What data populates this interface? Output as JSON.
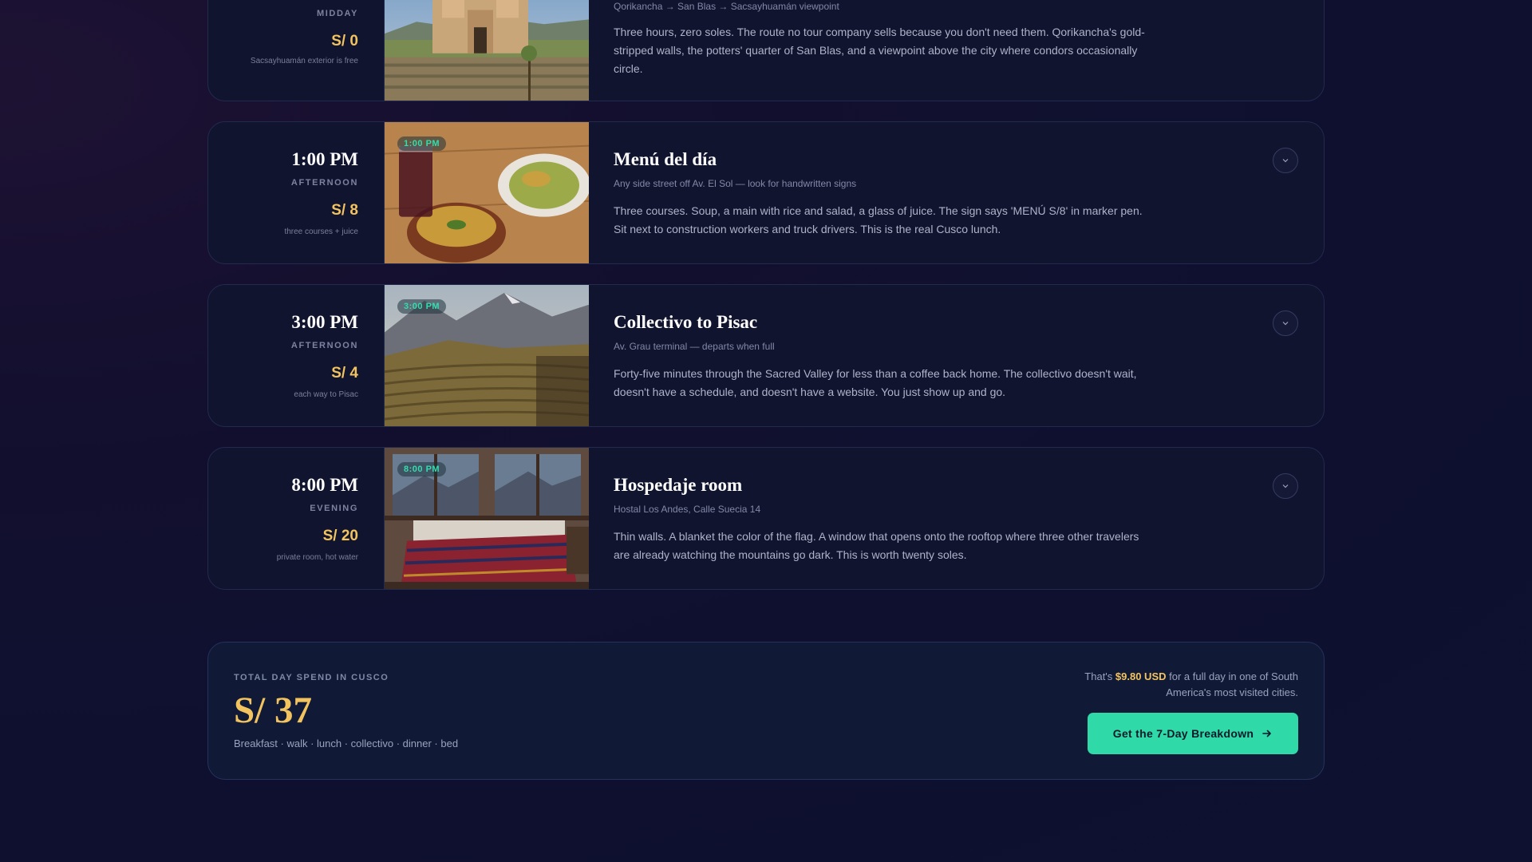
{
  "cards": [
    {
      "time": "",
      "period": "MIDDAY",
      "price": "S/ 0",
      "price_note": "Sacsayhuamán exterior is free",
      "badge": "",
      "title": "",
      "subtitle": "Qorikancha → San Blas → Sacsayhuamán viewpoint",
      "description": "Three hours, zero soles. The route no tour company sells because you don't need them. Qorikancha's gold-stripped walls, the potters' quarter of San Blas, and a viewpoint above the city where condors occasionally circle.",
      "image": "church-plaza-image"
    },
    {
      "time": "1:00 PM",
      "period": "AFTERNOON",
      "price": "S/ 8",
      "price_note": "three courses + juice",
      "badge": "1:00 PM",
      "title": "Menú del día",
      "subtitle": "Any side street off Av. El Sol — look for handwritten signs",
      "description": "Three courses. Soup, a main with rice and salad, a glass of juice. The sign says 'MENÚ S/8' in marker pen. Sit next to construction workers and truck drivers. This is the real Cusco lunch.",
      "image": "lunch-plates-image"
    },
    {
      "time": "3:00 PM",
      "period": "AFTERNOON",
      "price": "S/ 4",
      "price_note": "each way to Pisac",
      "badge": "3:00 PM",
      "title": "Collectivo to Pisac",
      "subtitle": "Av. Grau terminal — departs when full",
      "description": "Forty-five minutes through the Sacred Valley for less than a coffee back home. The collectivo doesn't wait, doesn't have a schedule, and doesn't have a website. You just show up and go.",
      "image": "sacred-valley-image"
    },
    {
      "time": "8:00 PM",
      "period": "EVENING",
      "price": "S/ 20",
      "price_note": "private room, hot water",
      "badge": "8:00 PM",
      "title": "Hospedaje room",
      "subtitle": "Hostal Los Andes, Calle Suecia 14",
      "description": "Thin walls. A blanket the color of the flag. A window that opens onto the rooftop where three other travelers are already watching the mountains go dark. This is worth twenty soles.",
      "image": "hostel-room-image"
    }
  ],
  "summary": {
    "label": "TOTAL DAY SPEND IN CUSCO",
    "total": "S/ 37",
    "items": "Breakfast · walk · lunch · collectivo · dinner · bed",
    "note_prefix": "That's ",
    "note_amount": "$9.80 USD",
    "note_suffix": " for a full day in one of South America's most visited cities.",
    "cta_label": "Get the 7-Day Breakdown"
  },
  "colors": {
    "accent": "#2fd9a8",
    "price": "#f3c35f",
    "background": "#0f1030"
  }
}
